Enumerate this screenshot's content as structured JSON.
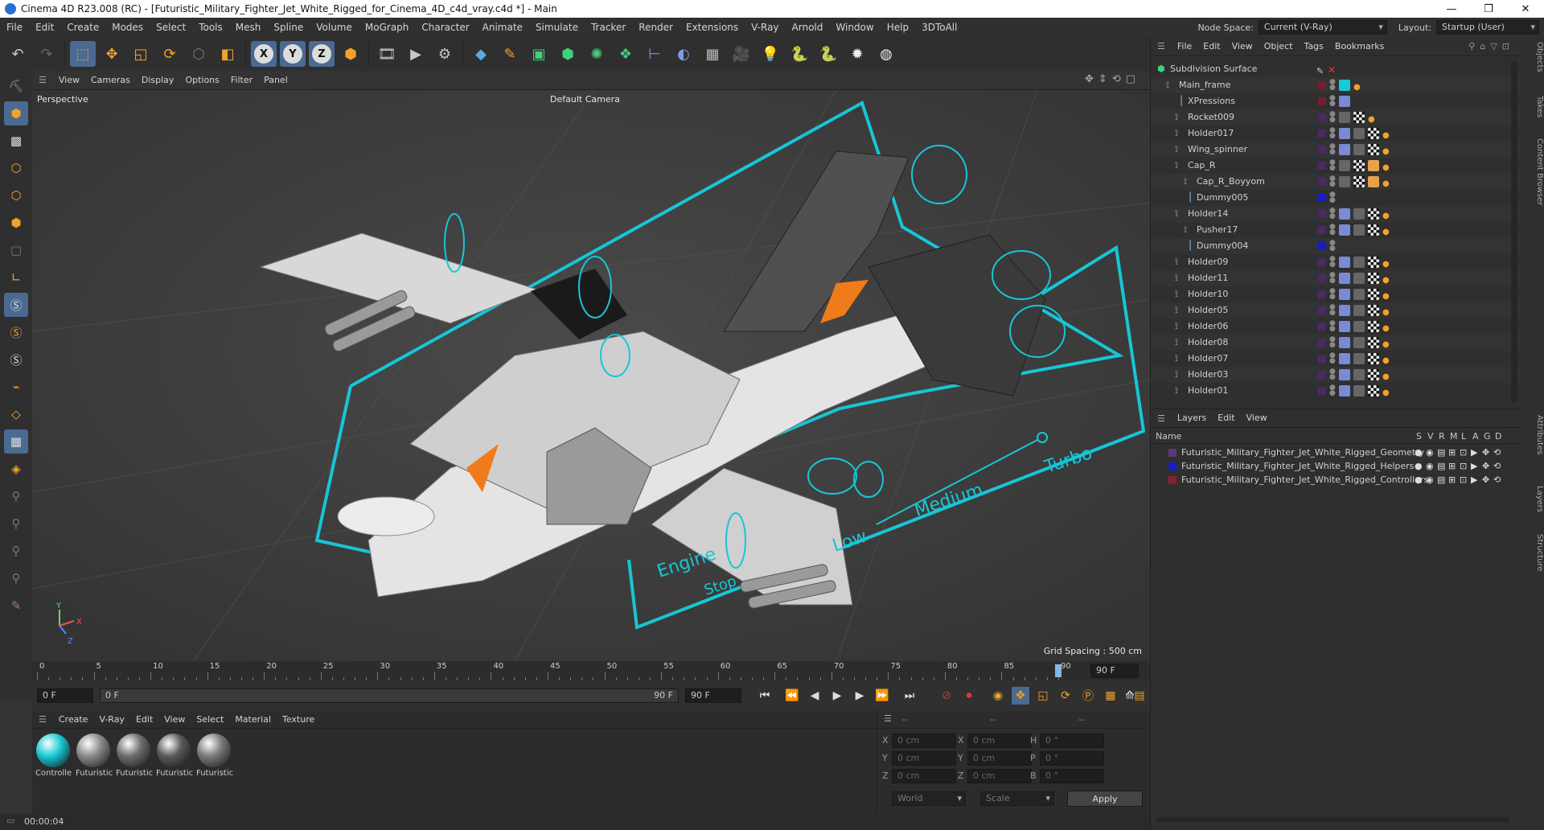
{
  "window": {
    "title": "Cinema 4D R23.008 (RC) - [Futuristic_Military_Fighter_Jet_White_Rigged_for_Cinema_4D_c4d_vray.c4d *] - Main",
    "minimize": "—",
    "maximize": "❐",
    "close": "✕"
  },
  "menubar": {
    "items": [
      "File",
      "Edit",
      "Create",
      "Modes",
      "Select",
      "Tools",
      "Mesh",
      "Spline",
      "Volume",
      "MoGraph",
      "Character",
      "Animate",
      "Simulate",
      "Tracker",
      "Render",
      "Extensions",
      "V-Ray",
      "Arnold",
      "Window",
      "Help",
      "3DToAll"
    ],
    "node_space_label": "Node Space:",
    "node_space_value": "Current (V-Ray)",
    "layout_label": "Layout:",
    "layout_value": "Startup (User)"
  },
  "viewport": {
    "menu": [
      "View",
      "Cameras",
      "Display",
      "Options",
      "Filter",
      "Panel"
    ],
    "view_label": "Perspective",
    "camera_label": "Default Camera",
    "grid_spacing": "Grid Spacing : 500 cm",
    "hud_labels": {
      "engine": "Engine",
      "stop": "Stop",
      "low": "Low",
      "medium": "Medium",
      "turbo": "Turbo"
    },
    "axis": {
      "x": "X",
      "y": "Y",
      "z": "Z"
    }
  },
  "timeline": {
    "ticks": [
      "0",
      "5",
      "10",
      "15",
      "20",
      "25",
      "30",
      "35",
      "40",
      "45",
      "50",
      "55",
      "60",
      "65",
      "70",
      "75",
      "80",
      "85",
      "90"
    ],
    "current_frame_label": "90 F",
    "playhead_fraction": 1.0
  },
  "transport": {
    "start_frame": "0 F",
    "range_start": "0 F",
    "range_end": "90 F",
    "end_frame": "90 F"
  },
  "material_manager": {
    "menu": [
      "Create",
      "V-Ray",
      "Edit",
      "View",
      "Select",
      "Material",
      "Texture"
    ],
    "materials": [
      {
        "name": "Controlle",
        "color": "#19c9d6"
      },
      {
        "name": "Futuristic",
        "color": "#8a8a8a"
      },
      {
        "name": "Futuristic",
        "color": "#6d6d6d"
      },
      {
        "name": "Futuristic",
        "color": "#5a5a5a"
      },
      {
        "name": "Futuristic",
        "color": "#7a7a7a"
      }
    ]
  },
  "coordinates": {
    "headers": [
      "--",
      "--",
      "--"
    ],
    "rows": [
      {
        "a": "X",
        "av": "0 cm",
        "b": "X",
        "bv": "0 cm",
        "c": "H",
        "cv": "0 °"
      },
      {
        "a": "Y",
        "av": "0 cm",
        "b": "Y",
        "bv": "0 cm",
        "c": "P",
        "cv": "0 °"
      },
      {
        "a": "Z",
        "av": "0 cm",
        "b": "Z",
        "bv": "0 cm",
        "c": "B",
        "cv": "0 °"
      }
    ],
    "mode1": "World",
    "mode2": "Scale",
    "apply": "Apply"
  },
  "status": {
    "time": "00:00:04"
  },
  "object_manager": {
    "menu": [
      "File",
      "Edit",
      "View",
      "Object",
      "Tags",
      "Bookmarks"
    ],
    "objects": [
      {
        "name": "Subdivision Surface",
        "indent": 0,
        "color": "",
        "tags": "sds"
      },
      {
        "name": "Main_frame",
        "indent": 1,
        "color": "#7a1e2e",
        "tags": "main"
      },
      {
        "name": "XPressions",
        "indent": 2,
        "color": "#7a1e2e",
        "tags": "xp"
      },
      {
        "name": "Rocket009",
        "indent": 2,
        "color": "#4a2a66",
        "tags": "std"
      },
      {
        "name": "Holder017",
        "indent": 2,
        "color": "#4a2a66",
        "tags": "full"
      },
      {
        "name": "Wing_spinner",
        "indent": 2,
        "color": "#4a2a66",
        "tags": "full"
      },
      {
        "name": "Cap_R",
        "indent": 2,
        "color": "#4a2a66",
        "tags": "std2"
      },
      {
        "name": "Cap_R_Boyyom",
        "indent": 3,
        "color": "#4a2a66",
        "tags": "std2"
      },
      {
        "name": "Dummy005",
        "indent": 3,
        "color": "#1a1acc",
        "tags": ""
      },
      {
        "name": "Holder14",
        "indent": 2,
        "color": "#4a2a66",
        "tags": "full"
      },
      {
        "name": "Pusher17",
        "indent": 3,
        "color": "#4a2a66",
        "tags": "full"
      },
      {
        "name": "Dummy004",
        "indent": 3,
        "color": "#1a1acc",
        "tags": ""
      },
      {
        "name": "Holder09",
        "indent": 2,
        "color": "#4a2a66",
        "tags": "full"
      },
      {
        "name": "Holder11",
        "indent": 2,
        "color": "#4a2a66",
        "tags": "full"
      },
      {
        "name": "Holder10",
        "indent": 2,
        "color": "#4a2a66",
        "tags": "full"
      },
      {
        "name": "Holder05",
        "indent": 2,
        "color": "#4a2a66",
        "tags": "full"
      },
      {
        "name": "Holder06",
        "indent": 2,
        "color": "#4a2a66",
        "tags": "full"
      },
      {
        "name": "Holder08",
        "indent": 2,
        "color": "#4a2a66",
        "tags": "full"
      },
      {
        "name": "Holder07",
        "indent": 2,
        "color": "#4a2a66",
        "tags": "full"
      },
      {
        "name": "Holder03",
        "indent": 2,
        "color": "#4a2a66",
        "tags": "full"
      },
      {
        "name": "Holder01",
        "indent": 2,
        "color": "#4a2a66",
        "tags": "full"
      }
    ]
  },
  "layer_manager": {
    "menu": [
      "Layers",
      "Edit",
      "View"
    ],
    "name_header": "Name",
    "flag_headers": [
      "S",
      "V",
      "R",
      "M",
      "L",
      "A",
      "G",
      "D"
    ],
    "layers": [
      {
        "name": "Futuristic_Military_Fighter_Jet_White_Rigged_Geometry",
        "color": "#5a3a7a"
      },
      {
        "name": "Futuristic_Military_Fighter_Jet_White_Rigged_Helpers",
        "color": "#1a1acc"
      },
      {
        "name": "Futuristic_Military_Fighter_Jet_White_Rigged_Controllers",
        "color": "#8a1e2e"
      }
    ]
  },
  "side_tabs": {
    "top": [
      "Objects",
      "Takes",
      "Content Browser"
    ],
    "bottom": [
      "Attributes",
      "Layers",
      "Structure"
    ]
  }
}
